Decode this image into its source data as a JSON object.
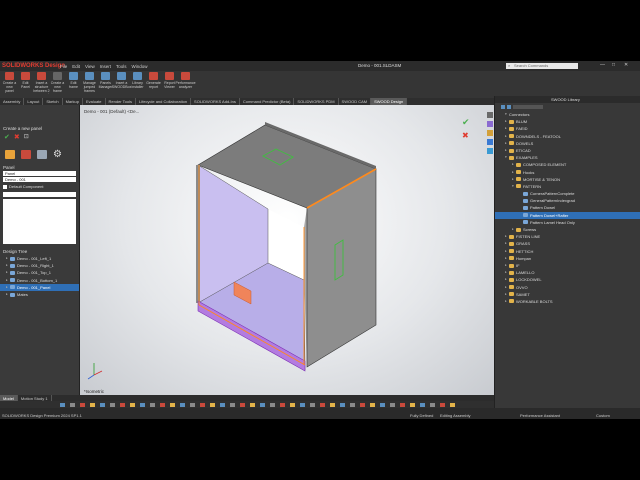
{
  "app": {
    "name": "SOLIDWORKS Design",
    "doc_title": "Demo - 001.SLDASM"
  },
  "menus": [
    "File",
    "Edit",
    "View",
    "Insert",
    "Tools",
    "Window"
  ],
  "search_placeholder": "Search Commands",
  "ribbon": [
    {
      "label": "Create a new panel",
      "color": "#c94a3c"
    },
    {
      "label": "Edit Panel",
      "color": "#c94a3c"
    },
    {
      "label": "Insert a structure between 2 components",
      "color": "#c94a3c"
    },
    {
      "label": "Create a new frame",
      "color": "#666666"
    },
    {
      "label": "Edit frame",
      "color": "#5a8fbf"
    },
    {
      "label": "Manage jumped frames",
      "color": "#5a8fbf"
    },
    {
      "label": "Panels Manager",
      "color": "#5a8fbf"
    },
    {
      "label": "Insert a SWOODBox",
      "color": "#5a8fbf"
    },
    {
      "label": "Library installer",
      "color": "#5a8fbf"
    },
    {
      "label": "Generate report",
      "color": "#c94a3c"
    },
    {
      "label": "Report Viewer",
      "color": "#c94a3c"
    },
    {
      "label": "Performance analyzer",
      "color": "#c94a3c"
    }
  ],
  "command_tabs": [
    "Assembly",
    "Layout",
    "Sketch",
    "Markup",
    "Evaluate",
    "Render Tools",
    "Lifecycle and Collaboration",
    "SOLIDWORKS Add-Ins",
    "Command Predictor (Beta)",
    "SOLIDWORKS PDM",
    "SWOOD CAM",
    "SWOOD Design"
  ],
  "active_tab_index": 11,
  "left_panel": {
    "title": "Create a new panel",
    "panel_header": "Panel",
    "field1": "Panel",
    "field2": "Demo - 001",
    "checkbox_label": "Default Component",
    "design_tree_header": "Design Tree",
    "tree": [
      "Demo - 001_Left_1",
      "Demo - 001_Right_1",
      "Demo - 001_Top_1",
      "Demo - 001_Bottom_1",
      "Demo - 001_Panel",
      "Mates"
    ],
    "selected_tree_index": 4
  },
  "viewport": {
    "doc_label": "Demo - 001 (Default) <De...",
    "view_label": "*Isometric"
  },
  "right_panel": {
    "title": "SWOOD Library",
    "root": "Connectors",
    "items": [
      {
        "label": "BLUM",
        "depth": 0,
        "open": false,
        "kind": "folder"
      },
      {
        "label": "FAEID",
        "depth": 0,
        "open": false,
        "kind": "folder"
      },
      {
        "label": "DOWNDELS - FEATOOL",
        "depth": 0,
        "open": false,
        "kind": "folder"
      },
      {
        "label": "DOWELS",
        "depth": 0,
        "open": false,
        "kind": "folder"
      },
      {
        "label": "ETICAD",
        "depth": 0,
        "open": false,
        "kind": "folder"
      },
      {
        "label": "EXAMPLES",
        "depth": 0,
        "open": true,
        "kind": "folder"
      },
      {
        "label": "COMPOSED ELEMENT",
        "depth": 1,
        "open": false,
        "kind": "folder"
      },
      {
        "label": "Hooks",
        "depth": 1,
        "open": false,
        "kind": "folder"
      },
      {
        "label": "MORTISE & TENON",
        "depth": 1,
        "open": false,
        "kind": "folder"
      },
      {
        "label": "PATTERN",
        "depth": 1,
        "open": true,
        "kind": "folder"
      },
      {
        "label": "CorneraPatternComplete",
        "depth": 2,
        "open": false,
        "kind": "pattern"
      },
      {
        "label": "GeneralPatternIndexgrad",
        "depth": 2,
        "open": false,
        "kind": "pattern"
      },
      {
        "label": "Pattern Dowel",
        "depth": 2,
        "open": false,
        "kind": "pattern"
      },
      {
        "label": "Pattern Dowel+Rafter",
        "depth": 2,
        "open": false,
        "kind": "pattern"
      },
      {
        "label": "Pattern Lamel Head Only",
        "depth": 2,
        "open": false,
        "kind": "pattern"
      },
      {
        "label": "Screws",
        "depth": 1,
        "open": false,
        "kind": "folder"
      },
      {
        "label": "FISTEN LINE",
        "depth": 0,
        "open": false,
        "kind": "folder"
      },
      {
        "label": "GRASS",
        "depth": 0,
        "open": false,
        "kind": "folder"
      },
      {
        "label": "HETTICH",
        "depth": 0,
        "open": false,
        "kind": "folder"
      },
      {
        "label": "Hompan",
        "depth": 0,
        "open": false,
        "kind": "folder"
      },
      {
        "label": "IF",
        "depth": 0,
        "open": false,
        "kind": "folder"
      },
      {
        "label": "LAMELLO",
        "depth": 0,
        "open": false,
        "kind": "folder"
      },
      {
        "label": "LOCKDOWEL",
        "depth": 0,
        "open": false,
        "kind": "folder"
      },
      {
        "label": "OVVO",
        "depth": 0,
        "open": false,
        "kind": "folder"
      },
      {
        "label": "SAMET",
        "depth": 0,
        "open": false,
        "kind": "folder"
      },
      {
        "label": "WORKABLE BOLTS",
        "depth": 0,
        "open": false,
        "kind": "folder"
      }
    ],
    "selected_index": 13
  },
  "bottom_tabs": [
    "Model",
    "Motion Study 1"
  ],
  "status": {
    "left": "SOLIDWORKS Design Premium 2024 SP1.1",
    "defined": "Fully Defined",
    "mode": "Editing Assembly",
    "assistant": "Performance Assistant",
    "units": "Custom"
  },
  "colors": {
    "accent": "#e03c31",
    "selection": "#2f6fb6",
    "panel_purple": "#b37be0"
  }
}
